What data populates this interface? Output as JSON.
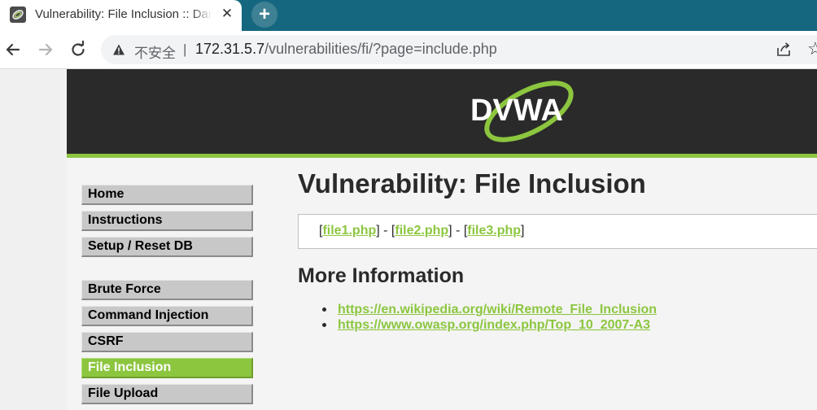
{
  "browser": {
    "tab_title": "Vulnerability: File Inclusion :: Damn Vulnerable Web Application (DVWA)",
    "tab_close": "✕",
    "new_tab": "+",
    "security_label": "不安全",
    "separator": "|",
    "url_host": "172.31.5.7",
    "url_path": "/vulnerabilities/fi/?page=include.php"
  },
  "header": {
    "logo_text": "DVWA"
  },
  "menu": {
    "items": [
      {
        "label": "Home"
      },
      {
        "label": "Instructions"
      },
      {
        "label": "Setup / Reset DB"
      },
      {
        "label": "Brute Force"
      },
      {
        "label": "Command Injection"
      },
      {
        "label": "CSRF"
      },
      {
        "label": "File Inclusion",
        "active": true
      },
      {
        "label": "File Upload"
      }
    ]
  },
  "main": {
    "title": "Vulnerability: File Inclusion",
    "files": {
      "open": "[",
      "close": "]",
      "sep": " - ",
      "links": [
        "file1.php",
        "file2.php",
        "file3.php"
      ]
    },
    "more_info_title": "More Information",
    "references": [
      "https://en.wikipedia.org/wiki/Remote_File_Inclusion",
      "https://www.owasp.org/index.php/Top_10_2007-A3"
    ]
  },
  "colors": {
    "accent": "#8cc63f",
    "header_bg": "#2a2a2a",
    "tabstrip_bg": "#15677f"
  }
}
